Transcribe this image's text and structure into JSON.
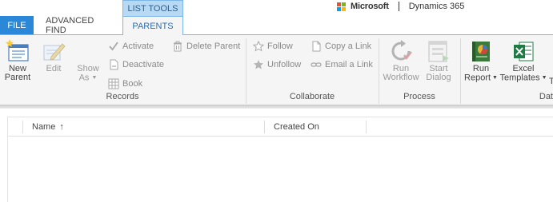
{
  "tabs": {
    "file": "FILE",
    "advanced_find": "ADVANCED FIND",
    "context_group": "LIST TOOLS",
    "parents": "PARENTS"
  },
  "brand": {
    "company": "Microsoft",
    "product": "Dynamics 365"
  },
  "ribbon": {
    "records": {
      "label": "Records",
      "new": [
        "New",
        "Parent"
      ],
      "edit": "Edit",
      "show_as": [
        "Show",
        "As"
      ],
      "activate": "Activate",
      "deactivate": "Deactivate",
      "book": "Book",
      "delete": "Delete Parent"
    },
    "collaborate": {
      "label": "Collaborate",
      "follow": "Follow",
      "unfollow": "Unfollow",
      "copy_link": "Copy a Link",
      "email_link": "Email a Link"
    },
    "process": {
      "label": "Process",
      "run_workflow": [
        "Run",
        "Workflow"
      ],
      "start_dialog": [
        "Start",
        "Dialog"
      ]
    },
    "data": {
      "label": "Dat",
      "run_report": [
        "Run",
        "Report"
      ],
      "excel_templates": [
        "Excel",
        "Templates"
      ],
      "truncated": "T"
    }
  },
  "grid": {
    "columns": [
      "Name",
      "Created On"
    ],
    "sort_indicator": "↑"
  },
  "colors": {
    "file_tab": "#2b88d8",
    "context_tab": "#b8d9f3",
    "ribbon_bg": "#f5f5f5",
    "ms_red": "#f25022",
    "ms_green": "#7fba00",
    "ms_blue": "#00a4ef",
    "ms_yellow": "#ffb900"
  }
}
